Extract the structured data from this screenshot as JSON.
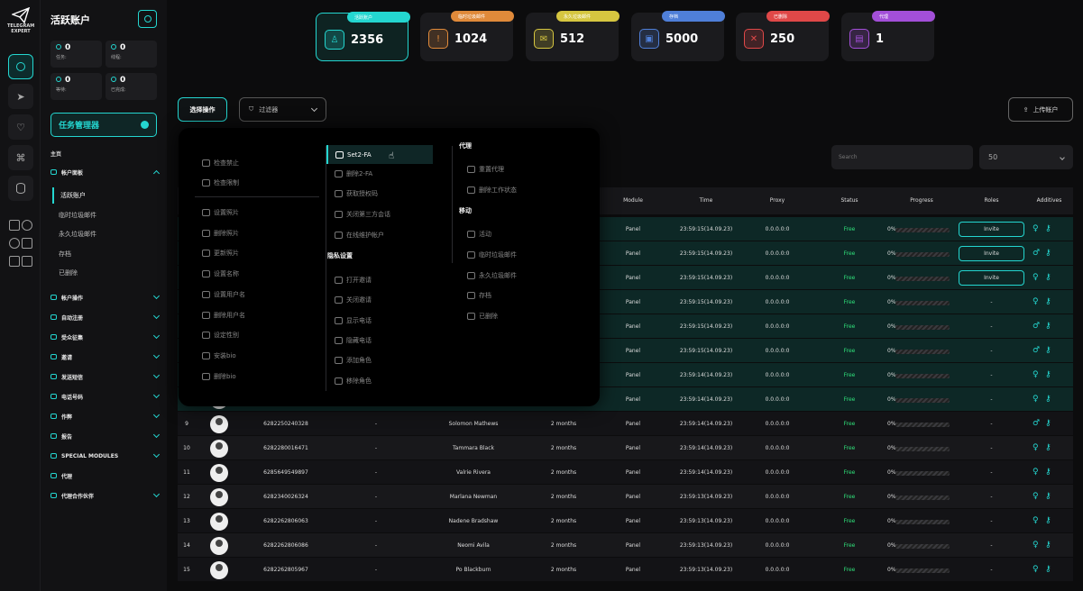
{
  "app": {
    "logo_text": "TELEGRAM EXPERT",
    "title": "活跃账户"
  },
  "side_stats": [
    {
      "value": "0",
      "label": "任务:"
    },
    {
      "value": "0",
      "label": "线程:"
    },
    {
      "value": "0",
      "label": "等待:"
    },
    {
      "value": "0",
      "label": "已完成:"
    }
  ],
  "task_manager": "任务管理器",
  "nav": {
    "home": "主页",
    "accounts_panel": "帐户面板",
    "sub_items": [
      "活跃账户",
      "临时垃圾邮件",
      "永久垃圾邮件",
      "存档",
      "已删除"
    ],
    "sections": [
      "帐户操作",
      "自动注册",
      "受众征集",
      "邀请",
      "发送短信",
      "电话号码",
      "作弊",
      "报告",
      "SPECIAL MODULES",
      "代理",
      "代理合作伙伴"
    ]
  },
  "cards": [
    {
      "tag": "活跃账户",
      "value": "2356",
      "color": "#24d6d0"
    },
    {
      "tag": "临时垃圾邮件",
      "value": "1024",
      "color": "#e08a3a"
    },
    {
      "tag": "永久垃圾邮件",
      "value": "512",
      "color": "#d6c640"
    },
    {
      "tag": "存档",
      "value": "5000",
      "color": "#4f7fd8"
    },
    {
      "tag": "已删除",
      "value": "250",
      "color": "#e04848"
    },
    {
      "tag": "代理",
      "value": "1",
      "color": "#a34fd8"
    }
  ],
  "toolbar": {
    "select_op": "选择操作",
    "filter": "过滤器",
    "upload": "上传帐户",
    "search_placeholder": "Search",
    "per_page": "50"
  },
  "table": {
    "headers": [
      "Module",
      "Time",
      "Proxy",
      "Status",
      "Progress",
      "Roles",
      "Additives"
    ],
    "rows": [
      {
        "idx": "",
        "phone": "",
        "dash": "",
        "name": "",
        "age": "",
        "module": "Panel",
        "time": "23:59:15(14.09.23)",
        "proxy": "0.0.0.0:0",
        "status": "Free",
        "progress": "0%",
        "role": "Invite",
        "gender": "♀"
      },
      {
        "idx": "",
        "phone": "",
        "dash": "",
        "name": "",
        "age": "",
        "module": "Panel",
        "time": "23:59:15(14.09.23)",
        "proxy": "0.0.0.0:0",
        "status": "Free",
        "progress": "0%",
        "role": "Invite",
        "gender": "♂"
      },
      {
        "idx": "",
        "phone": "",
        "dash": "",
        "name": "",
        "age": "",
        "module": "Panel",
        "time": "23:59:15(14.09.23)",
        "proxy": "0.0.0.0:0",
        "status": "Free",
        "progress": "0%",
        "role": "Invite",
        "gender": "♀"
      },
      {
        "idx": "",
        "phone": "",
        "dash": "",
        "name": "",
        "age": "",
        "module": "Panel",
        "time": "23:59:15(14.09.23)",
        "proxy": "0.0.0.0:0",
        "status": "Free",
        "progress": "0%",
        "role": "-",
        "gender": "♀"
      },
      {
        "idx": "",
        "phone": "",
        "dash": "",
        "name": "",
        "age": "",
        "module": "Panel",
        "time": "23:59:15(14.09.23)",
        "proxy": "0.0.0.0:0",
        "status": "Free",
        "progress": "0%",
        "role": "-",
        "gender": "♂"
      },
      {
        "idx": "",
        "phone": "",
        "dash": "",
        "name": "",
        "age": "",
        "module": "Panel",
        "time": "23:59:15(14.09.23)",
        "proxy": "0.0.0.0:0",
        "status": "Free",
        "progress": "0%",
        "role": "-",
        "gender": "♂"
      },
      {
        "idx": "",
        "phone": "",
        "dash": "",
        "name": "",
        "age": "",
        "module": "Panel",
        "time": "23:59:14(14.09.23)",
        "proxy": "0.0.0.0:0",
        "status": "Free",
        "progress": "0%",
        "role": "-",
        "gender": "♀"
      },
      {
        "idx": "",
        "phone": "",
        "dash": "",
        "name": "",
        "age": "",
        "module": "Panel",
        "time": "23:59:14(14.09.23)",
        "proxy": "0.0.0.0:0",
        "status": "Free",
        "progress": "0%",
        "role": "-",
        "gender": "♀"
      },
      {
        "idx": "9",
        "phone": "6282250240328",
        "dash": "-",
        "name": "Solomon Mathews",
        "age": "2 months",
        "module": "Panel",
        "time": "23:59:14(14.09.23)",
        "proxy": "0.0.0.0:0",
        "status": "Free",
        "progress": "0%",
        "role": "-",
        "gender": "♂"
      },
      {
        "idx": "10",
        "phone": "6282280016471",
        "dash": "-",
        "name": "Tammara Black",
        "age": "2 months",
        "module": "Panel",
        "time": "23:59:14(14.09.23)",
        "proxy": "0.0.0.0:0",
        "status": "Free",
        "progress": "0%",
        "role": "-",
        "gender": "♀"
      },
      {
        "idx": "11",
        "phone": "6285649549897",
        "dash": "-",
        "name": "Valrie Rivera",
        "age": "2 months",
        "module": "Panel",
        "time": "23:59:14(14.09.23)",
        "proxy": "0.0.0.0:0",
        "status": "Free",
        "progress": "0%",
        "role": "-",
        "gender": "♀"
      },
      {
        "idx": "12",
        "phone": "6282340026324",
        "dash": "-",
        "name": "Marlana Newman",
        "age": "2 months",
        "module": "Panel",
        "time": "23:59:13(14.09.23)",
        "proxy": "0.0.0.0:0",
        "status": "Free",
        "progress": "0%",
        "role": "-",
        "gender": "♀"
      },
      {
        "idx": "13",
        "phone": "6282262806063",
        "dash": "-",
        "name": "Nadene Bradshaw",
        "age": "2 months",
        "module": "Panel",
        "time": "23:59:13(14.09.23)",
        "proxy": "0.0.0.0:0",
        "status": "Free",
        "progress": "0%",
        "role": "-",
        "gender": "♀"
      },
      {
        "idx": "14",
        "phone": "6282262806086",
        "dash": "-",
        "name": "Neomi Avila",
        "age": "2 months",
        "module": "Panel",
        "time": "23:59:13(14.09.23)",
        "proxy": "0.0.0.0:0",
        "status": "Free",
        "progress": "0%",
        "role": "-",
        "gender": "♀"
      },
      {
        "idx": "15",
        "phone": "6282262805967",
        "dash": "-",
        "name": "Po Blackburn",
        "age": "2 months",
        "module": "Panel",
        "time": "23:59:13(14.09.23)",
        "proxy": "0.0.0.0:0",
        "status": "Free",
        "progress": "0%",
        "role": "-",
        "gender": "♀"
      }
    ]
  },
  "dropdown": {
    "col1": [
      "检查禁止",
      "检查限制",
      "设置照片",
      "删除照片",
      "更新照片",
      "设置名称",
      "设置用户名",
      "删除用户名",
      "设定性别",
      "安装bio",
      "删除bio"
    ],
    "col2_top": [
      "Set2-FA",
      "删除2-FA",
      "获取授权码",
      "关闭第三方会话",
      "在线维护帐户"
    ],
    "privacy_title": "隐私设置",
    "col2_privacy": [
      "打开邀请",
      "关闭邀请",
      "显示电话",
      "隐藏电话",
      "添加角色",
      "移除角色"
    ],
    "proxy_title": "代理",
    "col3_proxy": [
      "重置代理",
      "删除工作状态"
    ],
    "move_title": "移动",
    "col3_move": [
      "活动",
      "临时垃圾邮件",
      "永久垃圾邮件",
      "存档",
      "已删除"
    ]
  }
}
